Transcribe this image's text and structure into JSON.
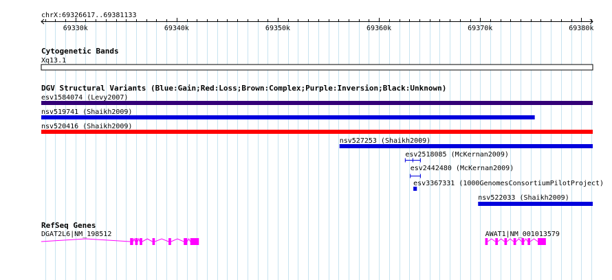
{
  "region": {
    "label": "chrX:69326617..69381133",
    "start": 69326617,
    "end": 69381133
  },
  "ruler": {
    "ticks": [
      {
        "pos": 69330000,
        "label": "69330k"
      },
      {
        "pos": 69340000,
        "label": "69340k"
      },
      {
        "pos": 69350000,
        "label": "69350k"
      },
      {
        "pos": 69360000,
        "label": "69360k"
      },
      {
        "pos": 69370000,
        "label": "69370k"
      },
      {
        "pos": 69380000,
        "label": "69380k"
      }
    ]
  },
  "cytoband": {
    "title": "Cytogenetic Bands",
    "band": "Xq13.1"
  },
  "dgv": {
    "title": "DGV Structural Variants (Blue:Gain;Red:Loss;Brown:Complex;Purple:Inversion;Black:Unknown)",
    "colors": {
      "gain": "#0000dd",
      "loss": "#ff0000",
      "inversion": "#330077"
    },
    "features": [
      {
        "label": "esv1584074 (Levy2007)",
        "type": "inversion",
        "start": 69326617,
        "end": 69381133,
        "style": "bar"
      },
      {
        "label": "nsv519741 (Shaikh2009)",
        "type": "gain",
        "start": 69326617,
        "end": 69375400,
        "style": "bar"
      },
      {
        "label": "nsv520416 (Shaikh2009)",
        "type": "loss",
        "start": 69326617,
        "end": 69381133,
        "style": "bar"
      },
      {
        "label": "nsv527253 (Shaikh2009)",
        "type": "gain",
        "start": 69356100,
        "end": 69381133,
        "style": "bar"
      },
      {
        "label": "esv2518085 (McKernan2009)",
        "type": "gain",
        "start": 69362600,
        "end": 69364100,
        "style": "span"
      },
      {
        "label": "esv2442480 (McKernan2009)",
        "type": "gain",
        "start": 69363100,
        "end": 69364100,
        "style": "span"
      },
      {
        "label": "esv3367331 (1000GenomesConsortiumPilotProject)",
        "type": "gain",
        "start": 69363400,
        "end": 69363750,
        "style": "box"
      },
      {
        "label": "nsv522033 (Shaikh2009)",
        "type": "gain",
        "start": 69369800,
        "end": 69381133,
        "style": "bar"
      }
    ]
  },
  "refseq": {
    "title": "RefSeq Genes",
    "color": "#ff00ff",
    "genes": [
      {
        "label": "DGAT2L6|NM_198512",
        "start": 69326617,
        "end": 69342200,
        "exons": [
          [
            69335400,
            69335700
          ],
          [
            69335900,
            69336150
          ],
          [
            69336350,
            69336600
          ],
          [
            69337600,
            69337850
          ],
          [
            69339200,
            69339450
          ],
          [
            69340700,
            69341050
          ],
          [
            69341350,
            69342200
          ]
        ]
      },
      {
        "label": "AWAT1|NM_001013579",
        "start": 69370500,
        "end": 69376500,
        "exons": [
          [
            69370500,
            69370750
          ],
          [
            69371500,
            69371750
          ],
          [
            69372400,
            69372650
          ],
          [
            69373300,
            69373550
          ],
          [
            69374100,
            69374350
          ],
          [
            69374700,
            69374950
          ],
          [
            69375700,
            69376500
          ]
        ]
      }
    ]
  }
}
